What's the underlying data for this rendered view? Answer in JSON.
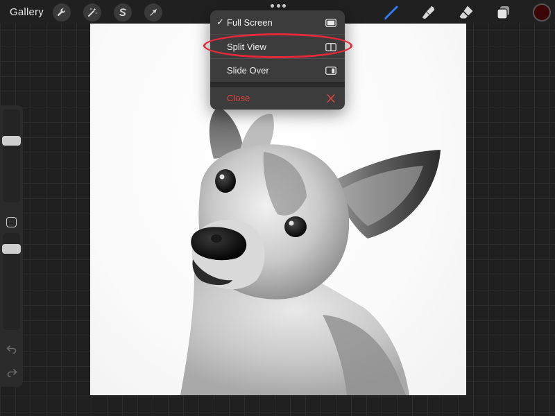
{
  "toolbar": {
    "gallery_label": "Gallery",
    "actions_icon": "wrench-icon",
    "adjustments_icon": "magic-wand-icon",
    "selection_icon": "selection-s-icon",
    "transform_icon": "arrow-cursor-icon",
    "brush_icon": "brush-icon",
    "smudge_icon": "smudge-icon",
    "eraser_icon": "eraser-icon",
    "layers_icon": "layers-icon",
    "current_color": "#3c0606",
    "brush_accent": "#2f7cf6"
  },
  "window_menu": {
    "items": [
      {
        "label": "Full Screen",
        "checked": true,
        "icon": "full-screen-icon"
      },
      {
        "label": "Split View",
        "checked": false,
        "icon": "split-view-icon",
        "highlighted": true
      },
      {
        "label": "Slide Over",
        "checked": false,
        "icon": "slide-over-icon"
      }
    ],
    "close": {
      "label": "Close",
      "icon": "close-x-icon",
      "color": "#e0443c"
    },
    "check_glyph": "✓"
  },
  "highlight_color": "#e4293a"
}
